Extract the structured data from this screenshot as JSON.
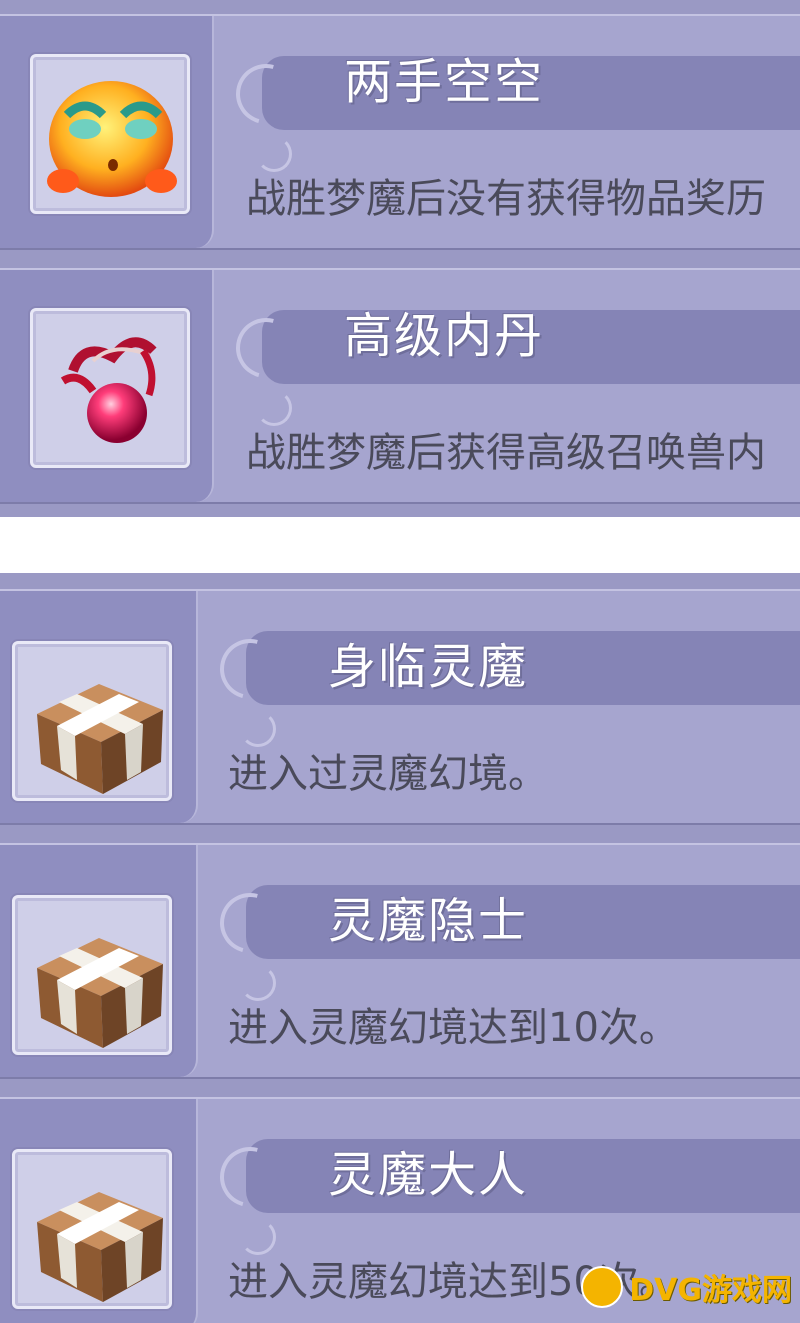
{
  "achievements_top": [
    {
      "title": "两手空空",
      "description": "战胜梦魔后没有获得物品奖历",
      "icon": "crying-face-icon"
    },
    {
      "title": "高级内丹",
      "description": "战胜梦魔后获得高级召唤兽内",
      "icon": "red-orb-icon"
    }
  ],
  "achievements_bottom": [
    {
      "title": "身临灵魔",
      "description": "进入过灵魔幻境。",
      "icon": "gift-box-icon"
    },
    {
      "title": "灵魔隐士",
      "description": "进入灵魔幻境达到10次。",
      "icon": "gift-box-icon"
    },
    {
      "title": "灵魔大人",
      "description": "进入灵魔幻境达到50次。",
      "icon": "gift-box-icon"
    }
  ],
  "watermark": {
    "text": "DVG游戏网",
    "icon": "gamepad-icon"
  },
  "colors": {
    "panel": "#9a99c4",
    "card": "#a6a5cf",
    "title_text": "#ffffff",
    "desc_text": "#4a4a5a",
    "watermark": "#f4b400"
  }
}
